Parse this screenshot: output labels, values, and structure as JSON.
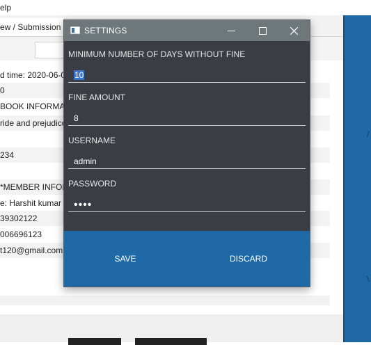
{
  "menubar": {
    "partial_label": "elp"
  },
  "tabs": {
    "active_label": "ew / Submission"
  },
  "details": {
    "rows": [
      "d time: 2020-06-0",
      "0",
      "BOOK INFORMAT",
      "ride and prejudice",
      "",
      "234",
      "",
      "*MEMBER INFOR",
      "e: Harshit kumar",
      "39302122",
      "006696123",
      "t120@gmail.com"
    ]
  },
  "right_strip": {
    "glyph_top": "/",
    "glyph_bottom": "\\"
  },
  "dialog": {
    "title": "SETTINGS",
    "icon": "app-window-icon",
    "controls": {
      "minimize": "minimize-icon",
      "maximize": "maximize-icon",
      "close": "close-icon"
    },
    "fields": {
      "min_days": {
        "label": "MINIMUM NUMBER OF DAYS WITHOUT FINE",
        "value": "10"
      },
      "fine_amount": {
        "label": "FINE AMOUNT",
        "value": "8"
      },
      "username": {
        "label": "USERNAME",
        "value": "admin"
      },
      "password": {
        "label": "PASSWORD",
        "value": "••••"
      }
    },
    "buttons": {
      "save": "SAVE",
      "discard": "DISCARD"
    }
  },
  "colors": {
    "dialog_bg": "#3a3d44",
    "titlebar": "#6e7779",
    "accent": "#1f6aa6",
    "selection": "#3b73c8"
  }
}
